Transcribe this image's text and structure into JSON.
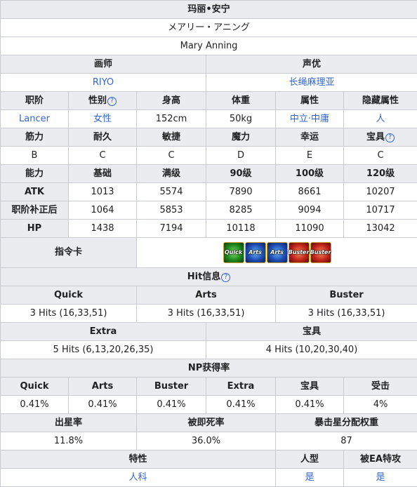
{
  "title": "玛丽•安宁",
  "name_jp": "メアリー・アニング",
  "name_en": "Mary Anning",
  "labels": {
    "illustrator": "画师",
    "voice": "声优",
    "class": "职阶",
    "gender": "性别",
    "height": "身高",
    "weight": "体重",
    "alignment": "属性",
    "hidden_attr": "隐藏属性",
    "str": "筋力",
    "end": "耐久",
    "agi": "敏捷",
    "mag": "魔力",
    "luk": "幸运",
    "np": "宝具",
    "ability": "能力",
    "base": "基础",
    "max": "满级",
    "lv90": "90级",
    "lv100": "100级",
    "lv120": "120级",
    "atk": "ATK",
    "class_atk": "职阶补正后",
    "hp": "HP",
    "command_cards": "指令卡",
    "hit_info": "Hit信息",
    "quick": "Quick",
    "arts": "Arts",
    "buster": "Buster",
    "extra": "Extra",
    "np_hit": "宝具",
    "np_gain": "NP获得率",
    "np_gain_np": "宝具",
    "np_gain_def": "受击",
    "star_gen": "出星率",
    "death_rate": "被即死率",
    "star_weight": "暴击星分配权重",
    "traits": "特性",
    "humanoid": "人型",
    "ea_weak": "被EA特攻"
  },
  "help_icon": "question-icon",
  "illustrator": "RIYO",
  "voice": "长绳麻理亚",
  "class": "Lancer",
  "gender": "女性",
  "height": "152cm",
  "weight": "50kg",
  "alignment": "中立·中庸",
  "hidden_attr": "人",
  "params": {
    "str": "B",
    "end": "C",
    "agi": "C",
    "mag": "D",
    "luk": "E",
    "np": "C"
  },
  "atk": {
    "base": "1013",
    "max": "5574",
    "lv90": "7890",
    "lv100": "8661",
    "lv120": "10207"
  },
  "class_atk": {
    "base": "1064",
    "max": "5853",
    "lv90": "8285",
    "lv100": "9094",
    "lv120": "10717"
  },
  "hp": {
    "base": "1438",
    "max": "7194",
    "lv90": "10118",
    "lv100": "11090",
    "lv120": "13042"
  },
  "cards": [
    {
      "type": "quick",
      "label": "Quick"
    },
    {
      "type": "arts",
      "label": "Arts"
    },
    {
      "type": "arts",
      "label": "Arts"
    },
    {
      "type": "buster",
      "label": "Buster"
    },
    {
      "type": "buster",
      "label": "Buster"
    }
  ],
  "hits": {
    "quick": "3 Hits (16,33,51)",
    "arts": "3 Hits (16,33,51)",
    "buster": "3 Hits (16,33,51)",
    "extra": "5 Hits (6,13,20,26,35)",
    "np": "4 Hits (10,20,30,40)"
  },
  "np_rates": {
    "quick": "0.41%",
    "arts": "0.41%",
    "buster": "0.41%",
    "extra": "0.41%",
    "np": "0.41%",
    "def": "4%"
  },
  "star_gen": "11.8%",
  "death_rate": "36.0%",
  "star_weight": "87",
  "traits": "人科",
  "humanoid": "是",
  "ea_weak": "是"
}
